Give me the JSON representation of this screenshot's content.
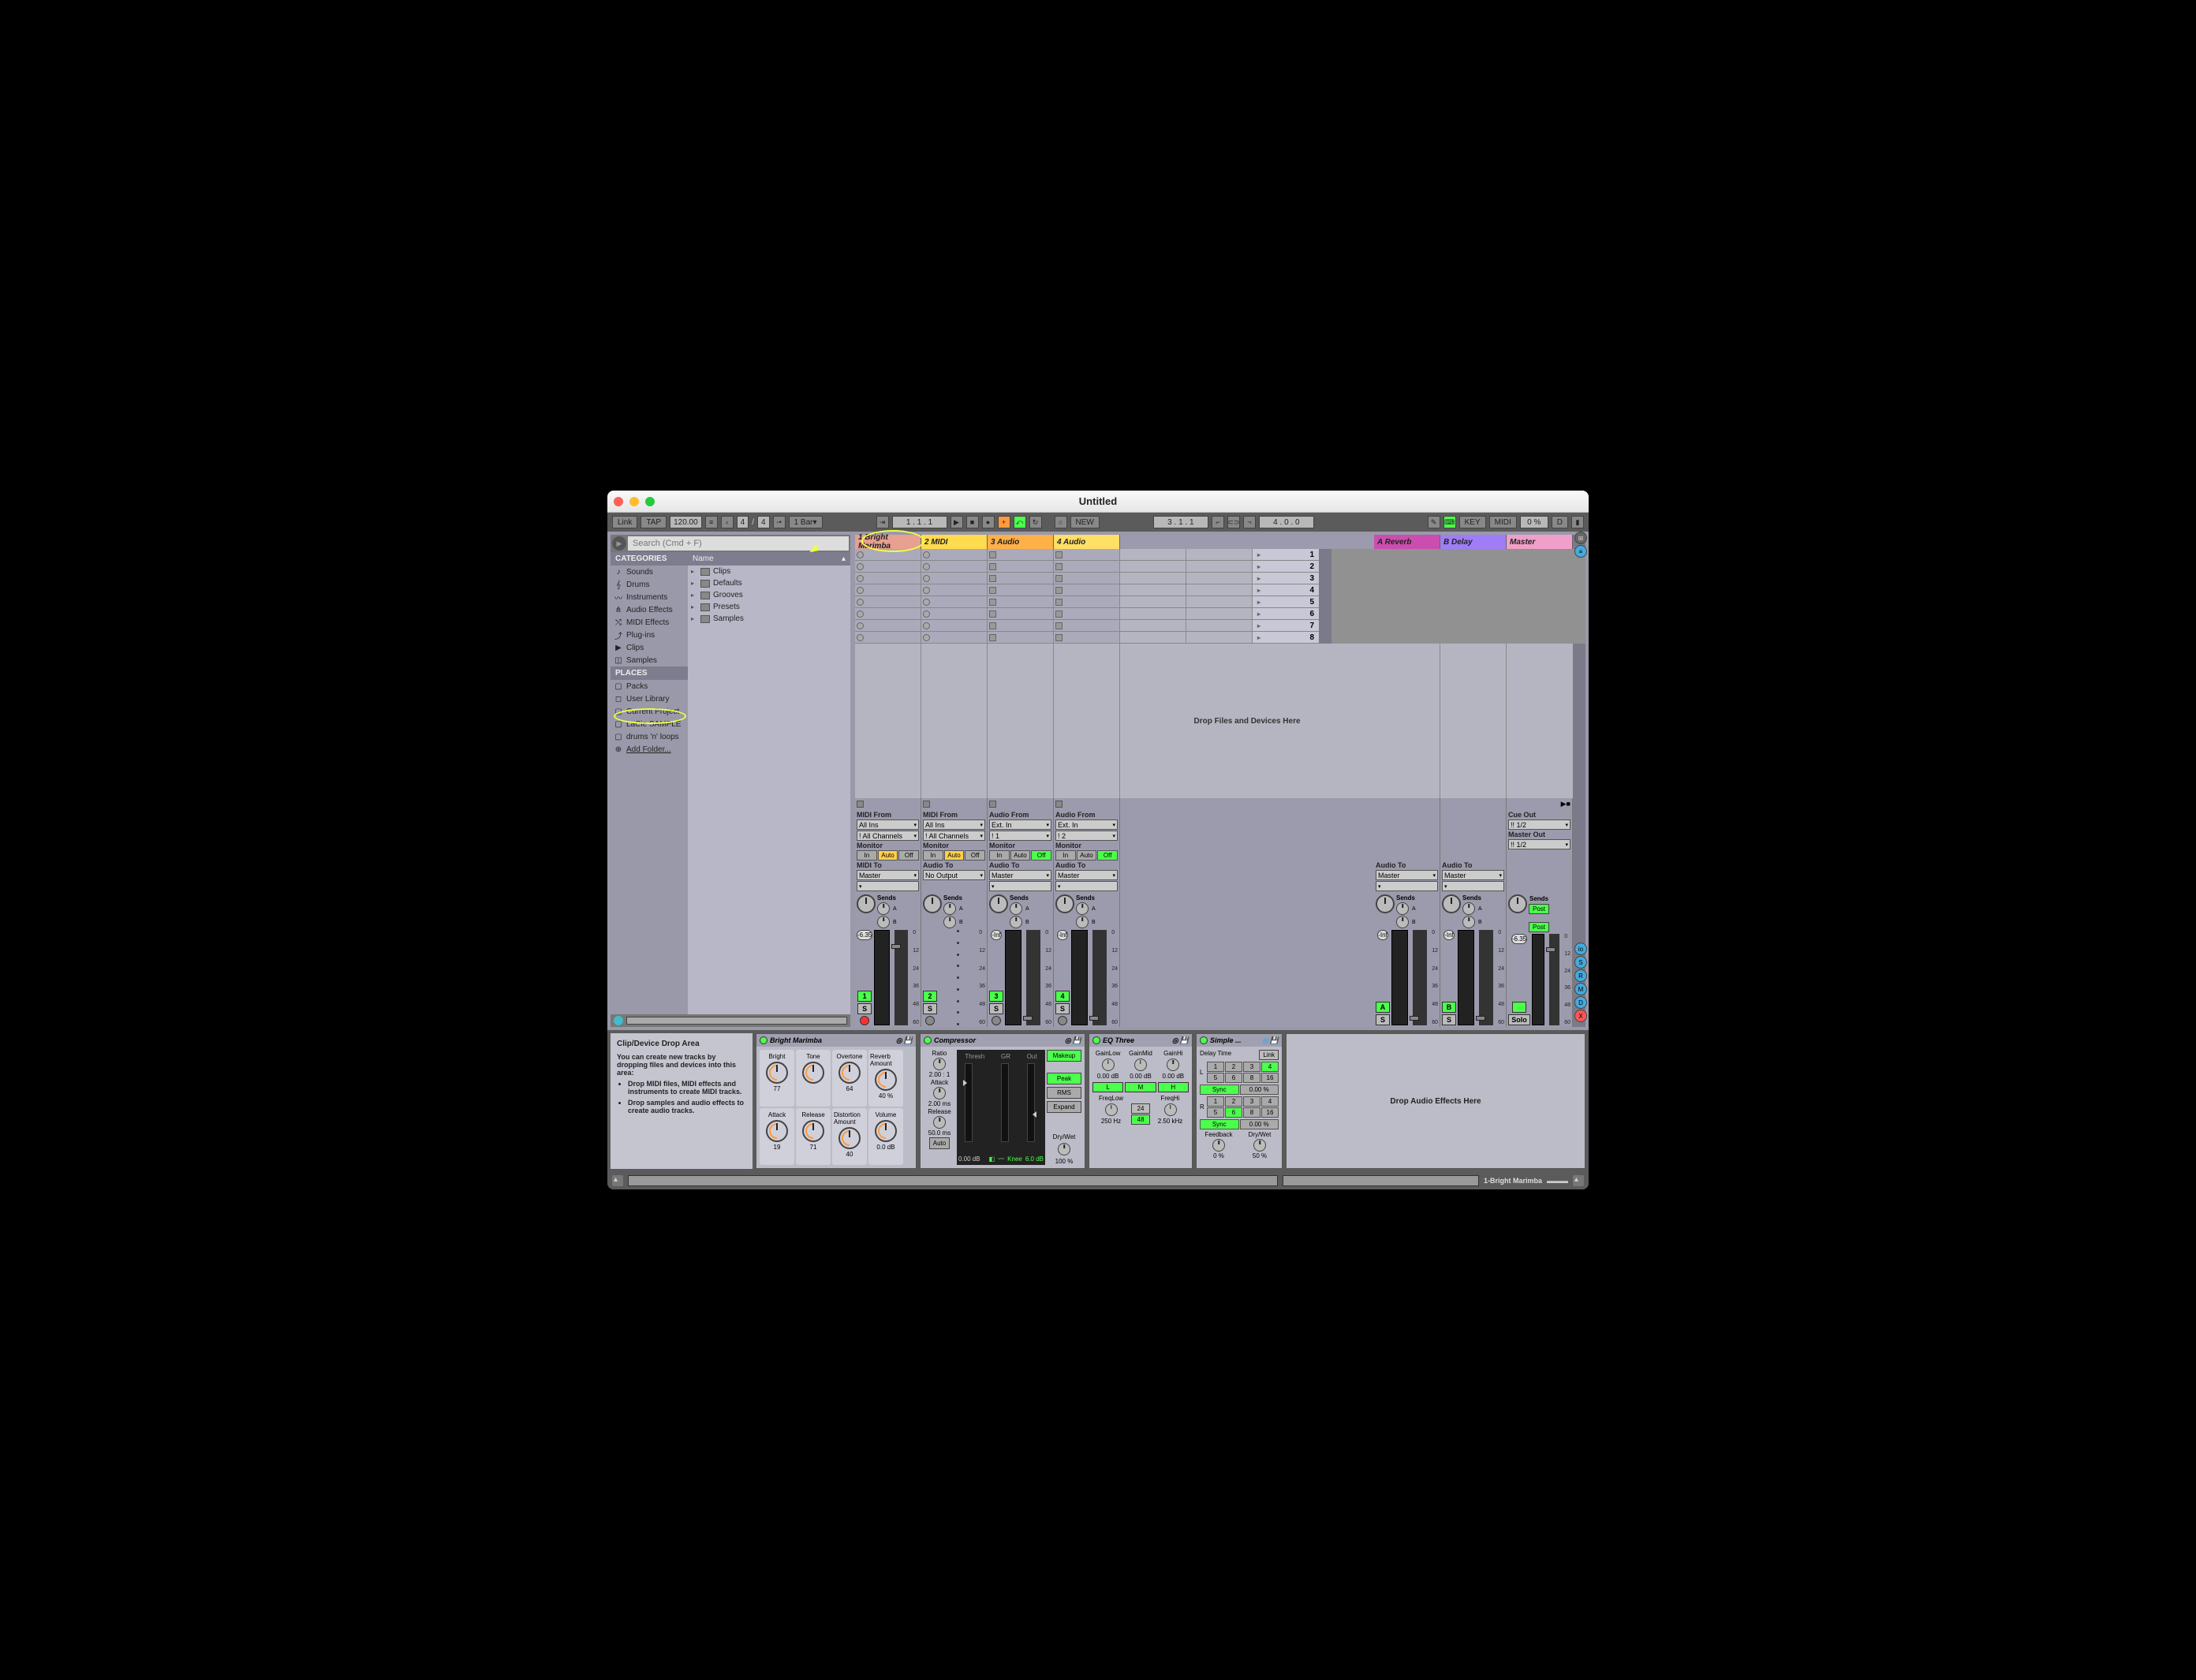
{
  "window": {
    "title": "Untitled"
  },
  "toolbar": {
    "link": "Link",
    "tap": "TAP",
    "tempo": "120.00",
    "sig_a": "4",
    "sig_b": "4",
    "bar": "1 Bar",
    "pos": "1 . 1 . 1",
    "new": "NEW",
    "loop_pos": "3 . 1 . 1",
    "loop_len": "4 . 0 . 0",
    "key": "KEY",
    "midi": "MIDI",
    "pct": "0 %",
    "d": "D"
  },
  "browser": {
    "search_ph": "Search (Cmd + F)",
    "cat_hdr": "CATEGORIES",
    "categories": [
      "Sounds",
      "Drums",
      "Instruments",
      "Audio Effects",
      "MIDI Effects",
      "Plug-ins",
      "Clips",
      "Samples"
    ],
    "places_hdr": "PLACES",
    "places": [
      "Packs",
      "User Library",
      "Current Project",
      "LaCie SAMPLE",
      "drums 'n' loops",
      "Add Folder..."
    ],
    "name_hdr": "Name",
    "folders": [
      "Clips",
      "Defaults",
      "Grooves",
      "Presets",
      "Samples"
    ]
  },
  "tracks": [
    {
      "name": "1 Bright Marimba",
      "color": "#e8a090",
      "w": 84,
      "type": "midi",
      "from": "MIDI From",
      "in": "All Ins",
      "ch": "! All Channels",
      "to_lbl": "MIDI To",
      "to": "Master",
      "vol": "-6.35",
      "act": "1",
      "mon": "auto"
    },
    {
      "name": "2 MIDI",
      "color": "#ffdb4d",
      "w": 84,
      "type": "midi",
      "from": "MIDI From",
      "in": "All Ins",
      "ch": "! All Channels",
      "to_lbl": "Audio To",
      "to": "No Output",
      "vol": "",
      "act": "2",
      "mon": "auto"
    },
    {
      "name": "3 Audio",
      "color": "#ffb048",
      "w": 84,
      "type": "audio",
      "from": "Audio From",
      "in": "Ext. In",
      "ch": "! 1",
      "to_lbl": "Audio To",
      "to": "Master",
      "vol": "-Inf",
      "act": "3",
      "mon": "off"
    },
    {
      "name": "4 Audio",
      "color": "#ffe066",
      "w": 84,
      "type": "audio",
      "from": "Audio From",
      "in": "Ext. In",
      "ch": "! 2",
      "to_lbl": "Audio To",
      "to": "Master",
      "vol": "-Inf",
      "act": "4",
      "mon": "off"
    }
  ],
  "returns": [
    {
      "name": "A Reverb",
      "color": "#cc4db0",
      "to": "Master",
      "vol": "-Inf",
      "act": "A"
    },
    {
      "name": "B Delay",
      "color": "#9f7df6",
      "to": "Master",
      "vol": "-Inf",
      "act": "B"
    }
  ],
  "master": {
    "name": "Master",
    "color": "#f0a0c8",
    "cue": "Cue Out",
    "cue_ch": "!! 1/2",
    "out": "Master Out",
    "out_ch": "!! 1/2",
    "vol": "-6.35",
    "sends": "Sends",
    "post": "Post",
    "solo": "Solo"
  },
  "scenes": [
    "1",
    "2",
    "3",
    "4",
    "5",
    "6",
    "7",
    "8"
  ],
  "drop_msg": "Drop Files and Devices Here",
  "io": {
    "monitor": "Monitor",
    "in": "In",
    "auto": "Auto",
    "off": "Off",
    "audio_to": "Audio To",
    "sends": "Sends"
  },
  "scale": [
    "0",
    "12",
    "24",
    "36",
    "48",
    "60"
  ],
  "info": {
    "title": "Clip/Device Drop Area",
    "desc": "You can create new tracks by dropping files and devices into this area:",
    "b1": "Drop MIDI files, MIDI effects and instruments to create MIDI tracks.",
    "b2": "Drop samples and audio effects to create audio tracks."
  },
  "devices": {
    "marimba": {
      "name": "Bright Marimba",
      "p": [
        {
          "l": "Bright",
          "v": "77"
        },
        {
          "l": "Tone",
          "v": ""
        },
        {
          "l": "Overtone",
          "v": "64"
        },
        {
          "l": "Reverb Amount",
          "v": "40 %"
        },
        {
          "l": "Attack",
          "v": "19"
        },
        {
          "l": "Release",
          "v": "71"
        },
        {
          "l": "Distortion Amount",
          "v": "40"
        },
        {
          "l": "Volume",
          "v": "0.0 dB"
        }
      ]
    },
    "comp": {
      "name": "Compressor",
      "ratio": "Ratio",
      "ratio_v": "2.00 : 1",
      "attack": "Attack",
      "attack_v": "2.00 ms",
      "release": "Release",
      "release_v": "50.0 ms",
      "auto": "Auto",
      "thresh": "Thresh",
      "gr": "GR",
      "out": "Out",
      "out_v": "0.00 dB",
      "knee": "Knee",
      "knee_v": "6.0 dB",
      "makeup": "Makeup",
      "peak": "Peak",
      "rms": "RMS",
      "expand": "Expand",
      "drywet": "Dry/Wet",
      "drywet_v": "100 %"
    },
    "eq": {
      "name": "EQ Three",
      "gl": "GainLow",
      "gm": "GainMid",
      "gh": "GainHi",
      "v": "0.00 dB",
      "l": "L",
      "m": "M",
      "h": "H",
      "fl": "FreqLow",
      "fl_v": "250 Hz",
      "fh": "FreqHi",
      "fh_v": "2.50 kHz",
      "n24": "24",
      "n48": "48"
    },
    "delay": {
      "name": "Simple ...",
      "dt": "Delay Time",
      "link": "Link",
      "sync": "Sync",
      "l": "L",
      "r": "R",
      "fb": "Feedback",
      "fb_v": "0 %",
      "dw": "Dry/Wet",
      "dw_v": "50 %",
      "pct": "0.00 %",
      "nums": [
        "1",
        "2",
        "3",
        "4",
        "5",
        "6",
        "8",
        "16"
      ]
    },
    "drop": "Drop Audio Effects Here"
  },
  "status": {
    "track": "1-Bright Marimba"
  }
}
